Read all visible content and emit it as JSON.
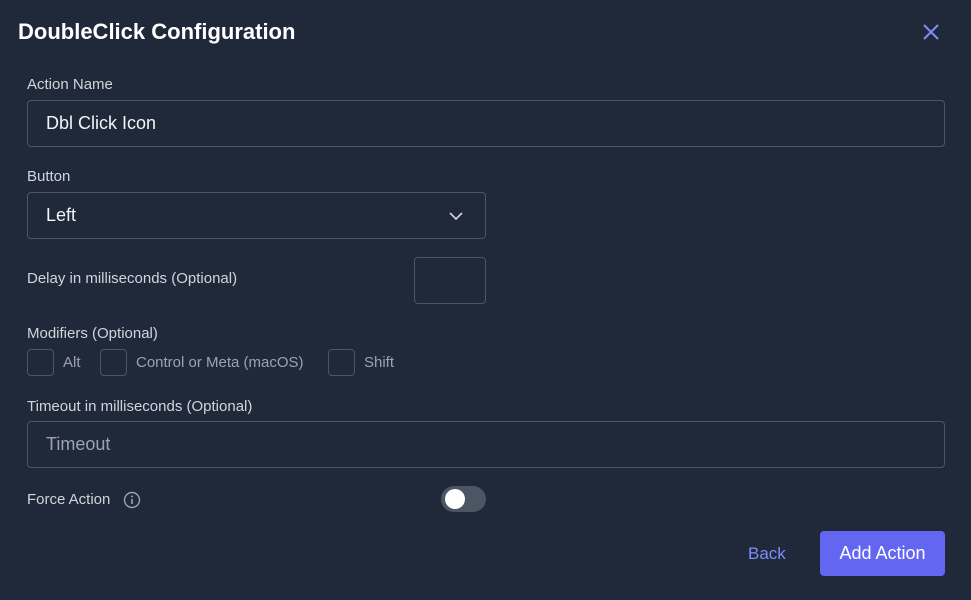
{
  "dialog": {
    "title": "DoubleClick Configuration"
  },
  "action_name": {
    "label": "Action Name",
    "value": "Dbl Click Icon"
  },
  "button": {
    "label": "Button",
    "selected": "Left"
  },
  "delay": {
    "label": "Delay in milliseconds (Optional)",
    "value": ""
  },
  "modifiers": {
    "label": "Modifiers (Optional)",
    "options": [
      {
        "label": "Alt",
        "checked": false
      },
      {
        "label": "Control or Meta (macOS)",
        "checked": false
      },
      {
        "label": "Shift",
        "checked": false
      }
    ]
  },
  "timeout": {
    "label": "Timeout in milliseconds (Optional)",
    "placeholder": "Timeout"
  },
  "force_action": {
    "label": "Force Action",
    "enabled": false
  },
  "footer": {
    "back": "Back",
    "add": "Add Action"
  },
  "colors": {
    "accent": "#6366f1",
    "background": "#1f293a"
  }
}
